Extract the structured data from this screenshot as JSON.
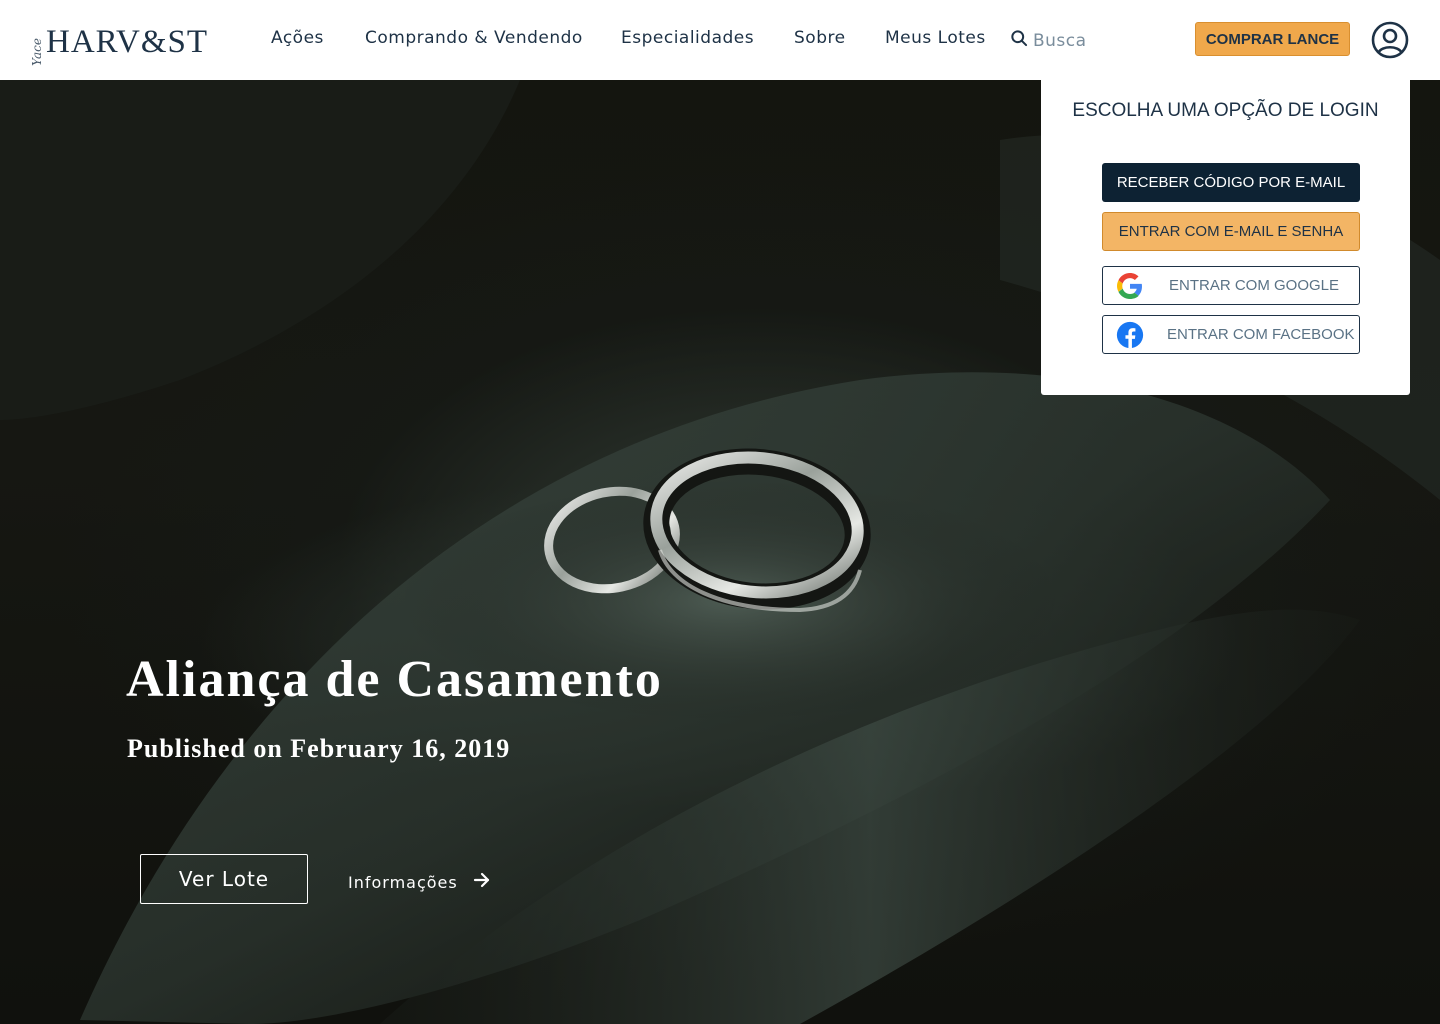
{
  "header": {
    "logo": {
      "script": "Yace",
      "wordmark": "HARV&ST"
    },
    "nav": [
      {
        "label": "Ações"
      },
      {
        "label": "Comprando & Vendendo"
      },
      {
        "label": "Especialidades"
      },
      {
        "label": "Sobre"
      },
      {
        "label": "Meus Lotes"
      }
    ],
    "search": {
      "label": "Busca",
      "icon": "search-icon"
    },
    "cta": {
      "label": "COMPRAR LANCE",
      "color": "#f0a84b"
    },
    "user": {
      "icon": "user-circle-icon"
    }
  },
  "hero": {
    "title": "Aliança de Casamento",
    "subtitle": "Published on February 16, 2019",
    "primary_button": "Ver Lote",
    "secondary_link": "Informações",
    "secondary_icon": "arrow-right-icon"
  },
  "login": {
    "title": "ESCOLHA UMA OPÇÃO DE LOGIN",
    "options": [
      {
        "label": "RECEBER CÓDIGO POR E-MAIL"
      },
      {
        "label": "ENTRAR COM E-MAIL E SENHA"
      },
      {
        "label": "ENTRAR COM GOOGLE",
        "icon": "google-icon"
      },
      {
        "label": "ENTRAR COM FACEBOOK",
        "icon": "facebook-icon"
      }
    ]
  },
  "colors": {
    "navy": "#1e3246",
    "accent": "#f0a84b",
    "dark_button": "#0d2233"
  }
}
